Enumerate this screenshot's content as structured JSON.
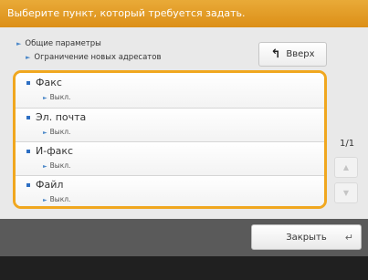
{
  "title": "Выберите пункт, который требуется задать.",
  "breadcrumb": {
    "level1": "Общие параметры",
    "level2": "Ограничение новых адресатов"
  },
  "up_button": {
    "label": "Вверх",
    "icon": "arrow-up-left-icon"
  },
  "items": [
    {
      "label": "Факс",
      "value": "Выкл."
    },
    {
      "label": "Эл. почта",
      "value": "Выкл."
    },
    {
      "label": "И-факс",
      "value": "Выкл."
    },
    {
      "label": "Файл",
      "value": "Выкл."
    }
  ],
  "pagination": {
    "indicator": "1/1"
  },
  "footer": {
    "close_label": "Закрыть",
    "close_icon": "return-icon"
  },
  "colors": {
    "accent": "#f0a71f",
    "title_bar": "#e29c27",
    "footer": "#5a5a5a",
    "bullet": "#2e6fc3"
  }
}
